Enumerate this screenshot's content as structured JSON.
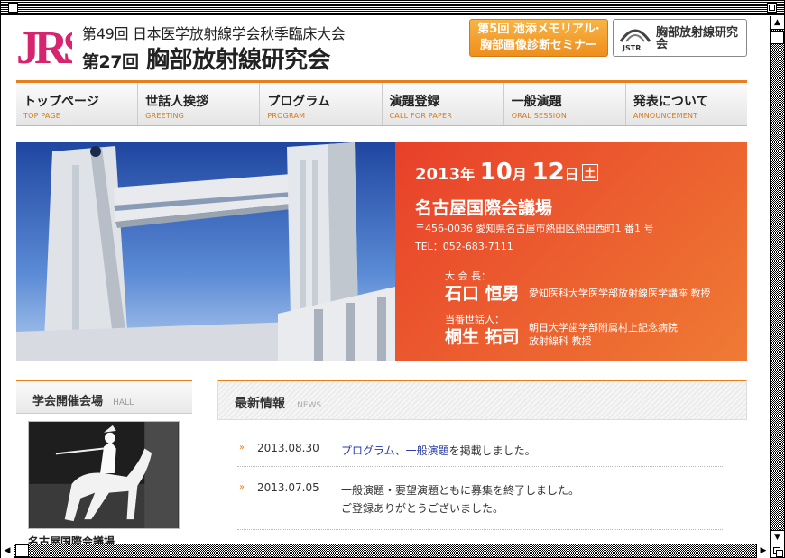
{
  "header": {
    "logo_text": "JRS",
    "conference_line1": "第49回 日本医学放射線学会秋季臨床大会",
    "conference_line2_num": "第27回",
    "conference_line2": "胸部放射線研究会",
    "banner_seminar_line1": "第5回 池添メモリアル·",
    "banner_seminar_line2": "胸部画像診断セミナー",
    "banner_jstr_logo": "JSTR",
    "banner_jstr_text": "胸部放射線研究会"
  },
  "nav": [
    {
      "jp": "トップページ",
      "en": "TOP PAGE"
    },
    {
      "jp": "世話人挨拶",
      "en": "GREETING"
    },
    {
      "jp": "プログラム",
      "en": "PROGRAM"
    },
    {
      "jp": "演題登録",
      "en": "CALL FOR PAPER"
    },
    {
      "jp": "一般演題",
      "en": "ORAL SESSION"
    },
    {
      "jp": "発表について",
      "en": "ANNOUNCEMENT"
    }
  ],
  "hero": {
    "year": "2013",
    "year_unit": "年",
    "month": "10",
    "month_unit": "月",
    "day": "12",
    "day_unit": "日",
    "weekday": "土",
    "venue": "名古屋国際会議場",
    "address": "〒456-0036 愛知県名古屋市熱田区熱田西町1 番1 号",
    "tel": "TEL：052-683-7111",
    "president_role": "大 会 長：",
    "president_name": "石口 恒男",
    "president_affil": "愛知医科大学医学部放射線医学講座 教授",
    "host_role": "当番世話人：",
    "host_name": "桐生 拓司",
    "host_affil_line1": "朝日大学歯学部附属村上記念病院",
    "host_affil_line2": "放射線科 教授"
  },
  "hall": {
    "title": "学会開催会場",
    "title_en": "HALL",
    "caption": "名古屋国際会議場"
  },
  "news": {
    "title": "最新情報",
    "title_en": "NEWS",
    "items": [
      {
        "date": "2013.08.30",
        "link1": "プログラム",
        "sep": "、",
        "link2": "一般演題",
        "text": "を掲載しました。"
      },
      {
        "date": "2013.07.05",
        "text": "一般演題・要望演題ともに募集を終了しました。",
        "text2": "ご登録ありがとうございました。"
      }
    ]
  },
  "colors": {
    "accent": "#e87e1c",
    "hero_red": "#e8402a",
    "link": "#2a3ca8"
  }
}
